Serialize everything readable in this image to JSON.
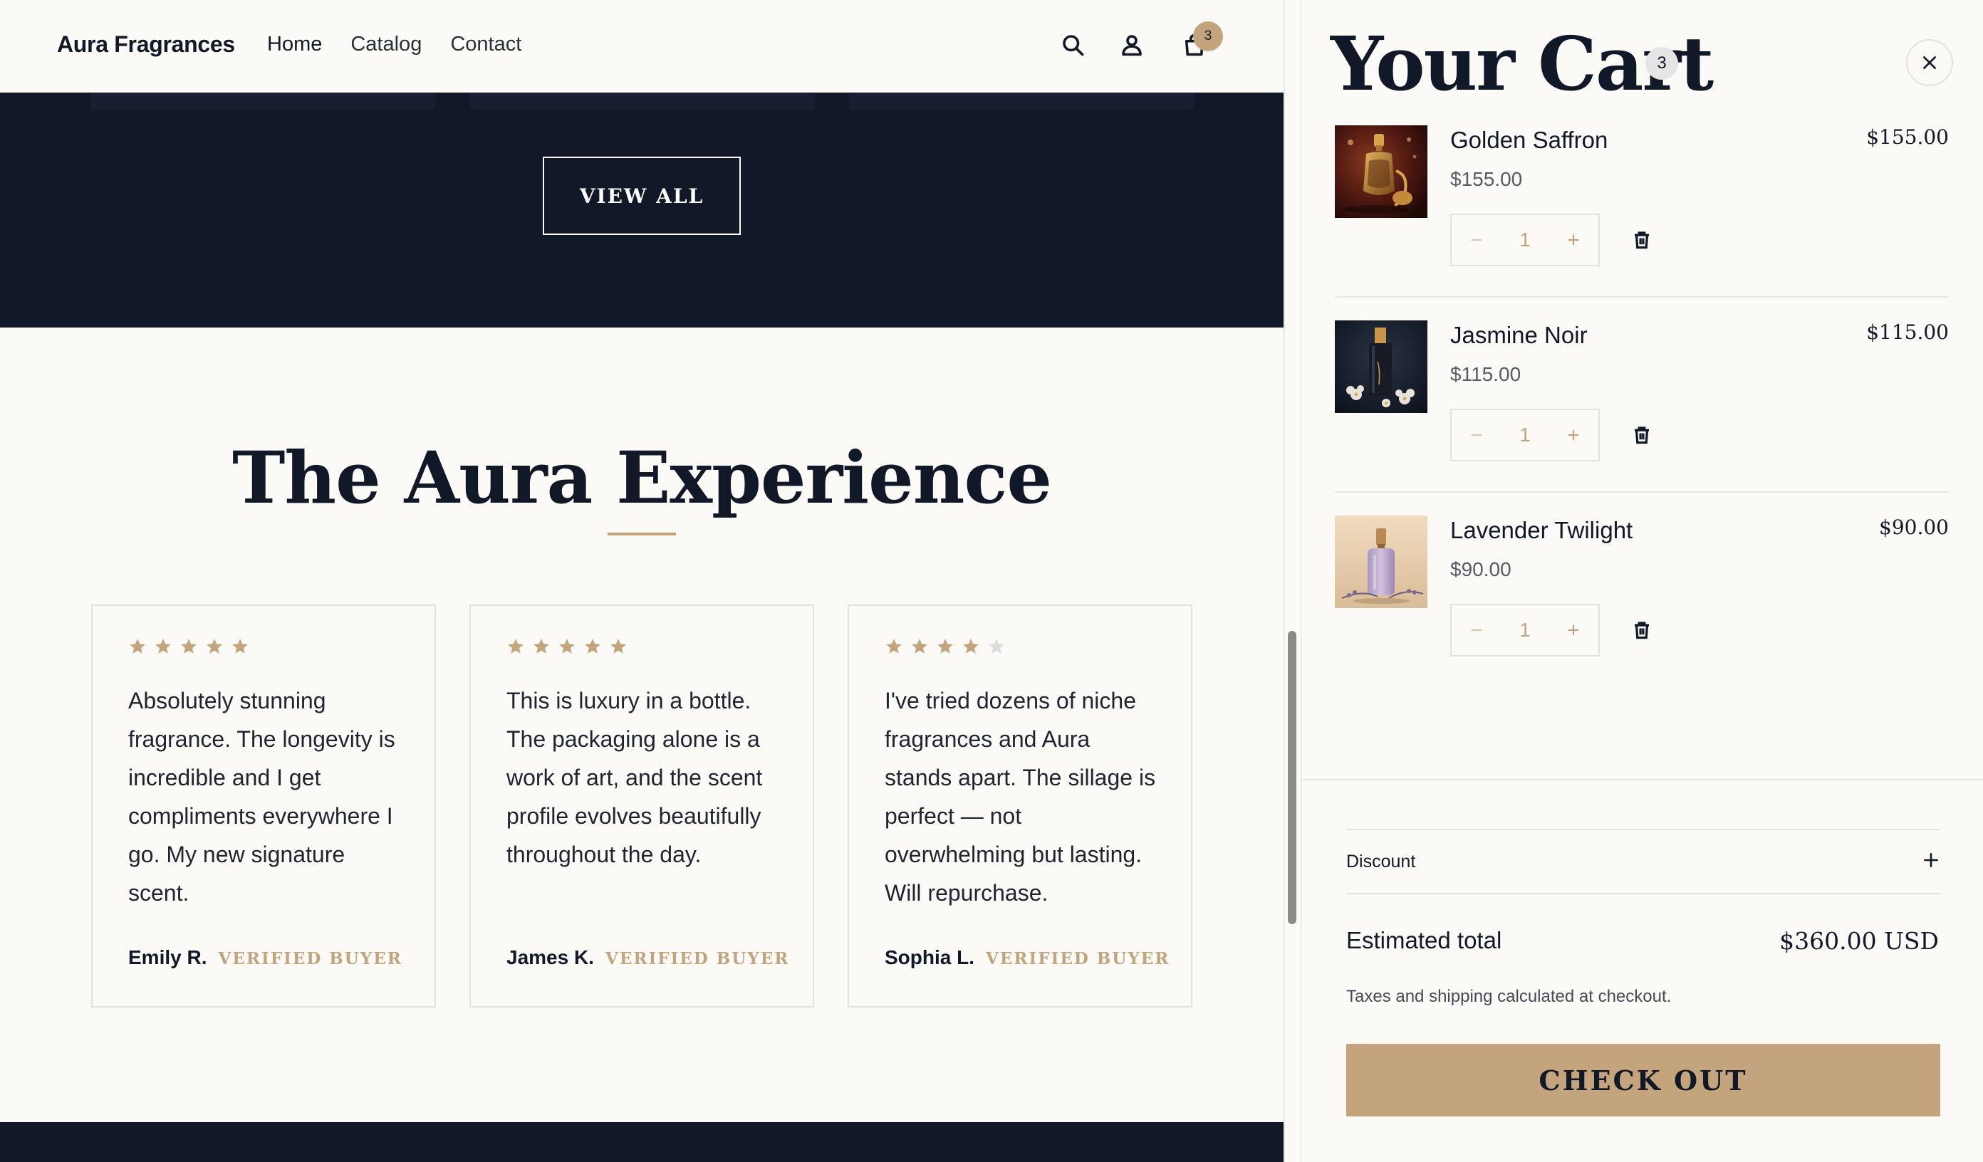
{
  "header": {
    "brand": "Aura Fragrances",
    "nav": [
      "Home",
      "Catalog",
      "Contact"
    ],
    "cart_badge": "3",
    "icons": [
      "search-icon",
      "user-icon",
      "bag-icon"
    ]
  },
  "hero_band": {
    "view_all_label": "VIEW ALL"
  },
  "experience": {
    "title": "The Aura Experience",
    "reviews": [
      {
        "rating": 5,
        "text": "Absolutely stunning fragrance. The longevity is incredible and I get compliments everywhere I go. My new signature scent.",
        "author": "Emily R.",
        "badge": "VERIFIED BUYER"
      },
      {
        "rating": 5,
        "text": "This is luxury in a bottle. The packaging alone is a work of art, and the scent profile evolves beautifully throughout the day.",
        "author": "James K.",
        "badge": "VERIFIED BUYER"
      },
      {
        "rating": 4,
        "text": "I've tried dozens of niche fragrances and Aura stands apart. The sillage is perfect — not overwhelming but lasting. Will repurchase.",
        "author": "Sophia L.",
        "badge": "VERIFIED BUYER"
      }
    ]
  },
  "cart": {
    "title": "Your Cart",
    "count": "3",
    "items": [
      {
        "name": "Golden Saffron",
        "unit_price": "$155.00",
        "quantity": "1",
        "line_total": "$155.00"
      },
      {
        "name": "Jasmine Noir",
        "unit_price": "$115.00",
        "quantity": "1",
        "line_total": "$115.00"
      },
      {
        "name": "Lavender Twilight",
        "unit_price": "$90.00",
        "quantity": "1",
        "line_total": "$90.00"
      }
    ],
    "discount_label": "Discount",
    "estimated_total_label": "Estimated total",
    "estimated_total_value": "$360.00 USD",
    "tax_note": "Taxes and shipping calculated at checkout.",
    "checkout_label": "CHECK OUT"
  },
  "colors": {
    "navy": "#111827",
    "gold": "#c4a47c",
    "cream": "#fbfaf7"
  }
}
